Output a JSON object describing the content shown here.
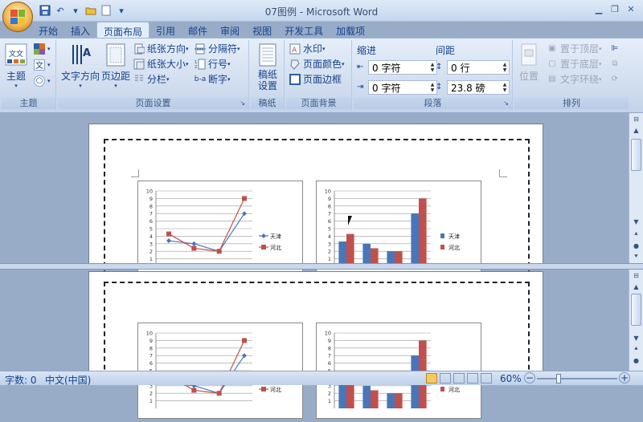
{
  "window": {
    "title": "07图例 - Microsoft Word"
  },
  "tabs": [
    "开始",
    "插入",
    "页面布局",
    "引用",
    "邮件",
    "审阅",
    "视图",
    "开发工具",
    "加载项"
  ],
  "active_tab_index": 2,
  "ribbon": {
    "theme_group": {
      "label": "主题",
      "theme_button": "主题"
    },
    "page_setup": {
      "label": "页面设置",
      "text_direction": "文字方向",
      "margins": "页边距",
      "orientation": "纸张方向",
      "size": "纸张大小",
      "columns": "分栏",
      "breaks": "分隔符",
      "line_numbers": "行号",
      "hyphenation": "断字"
    },
    "draft": {
      "label": "稿纸",
      "button": "稿纸设置"
    },
    "background": {
      "label": "页面背景",
      "watermark": "水印",
      "page_color": "页面颜色",
      "page_borders": "页面边框"
    },
    "paragraph": {
      "label": "段落",
      "indent_header": "缩进",
      "spacing_header": "间距",
      "indent_left": "0 字符",
      "indent_right": "0 字符",
      "spacing_before": "0 行",
      "spacing_after": "23.8 磅"
    },
    "arrange": {
      "label": "排列",
      "position": "位置",
      "bring_front": "置于顶层",
      "send_back": "置于底层",
      "text_wrap": "文字环绕"
    }
  },
  "status": {
    "word_count": "字数: 0",
    "language": "中文(中国)",
    "zoom": "60%"
  },
  "chart_data": [
    {
      "type": "line",
      "categories": [
        "",
        "",
        ""
      ],
      "ylim": [
        0,
        10
      ],
      "yticks": [
        "10",
        "9",
        "8",
        "7",
        "6",
        "5",
        "4",
        "3",
        "2",
        "1"
      ],
      "series": [
        {
          "name": "天津",
          "color": "#4a76b8",
          "values": [
            3.4,
            3,
            2,
            7
          ]
        },
        {
          "name": "河北",
          "color": "#c0504d",
          "values": [
            4.3,
            2.4,
            2,
            9
          ]
        }
      ]
    },
    {
      "type": "bar",
      "categories": [
        "",
        "",
        "",
        ""
      ],
      "ylim": [
        0,
        10
      ],
      "yticks": [
        "10",
        "9",
        "8",
        "7",
        "6",
        "5",
        "4",
        "3",
        "2",
        "1"
      ],
      "series": [
        {
          "name": "天津",
          "color": "#4a76b8",
          "values": [
            3.3,
            3,
            2,
            7
          ]
        },
        {
          "name": "河北",
          "color": "#c0504d",
          "values": [
            4.3,
            2.4,
            2,
            9
          ]
        }
      ]
    }
  ]
}
